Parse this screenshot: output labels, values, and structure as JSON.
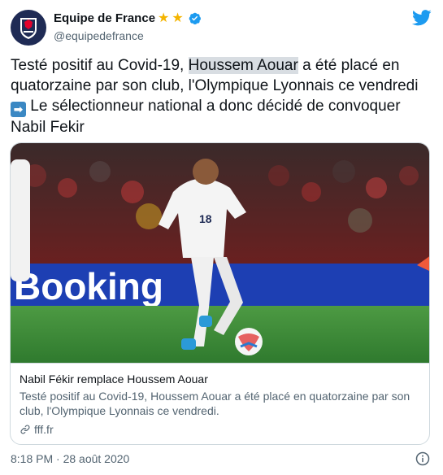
{
  "user": {
    "display_name": "Equipe de France",
    "handle": "@equipedefrance",
    "stars": [
      "★",
      "★"
    ],
    "avatar_icon": "fff-crest-icon",
    "verified_icon": "verified-badge-icon"
  },
  "tweet": {
    "text_before": "Testé positif au Covid-19, ",
    "text_highlight": "Houssem Aouar",
    "text_middle": " a été placé en quatorzaine par son club, l'Olympique Lyonnais ce vendredi ",
    "arrow": "➡",
    "text_after": " Le sélectionneur national a donc décidé de convoquer Nabil Fekir",
    "timestamp": "8:18 PM · 28 août 2020"
  },
  "card": {
    "image_alt_icon": "player-photo-image",
    "jersey_number": "18",
    "banner_text": "Booking",
    "title": "Nabil Fékir remplace Houssem Aouar",
    "description": "Testé positif au Covid-19, Houssem Aouar a été placé en quatorzaine par son club, l'Olympique Lyonnais ce vendredi.",
    "domain": "fff.fr"
  },
  "colors": {
    "accent": "#1d9bf0",
    "star": "#f4b400",
    "text": "#0f1419",
    "muted": "#536471",
    "highlight": "#d8dde2",
    "pitch": "#3f8a3a",
    "banner": "#1d3fb3"
  }
}
